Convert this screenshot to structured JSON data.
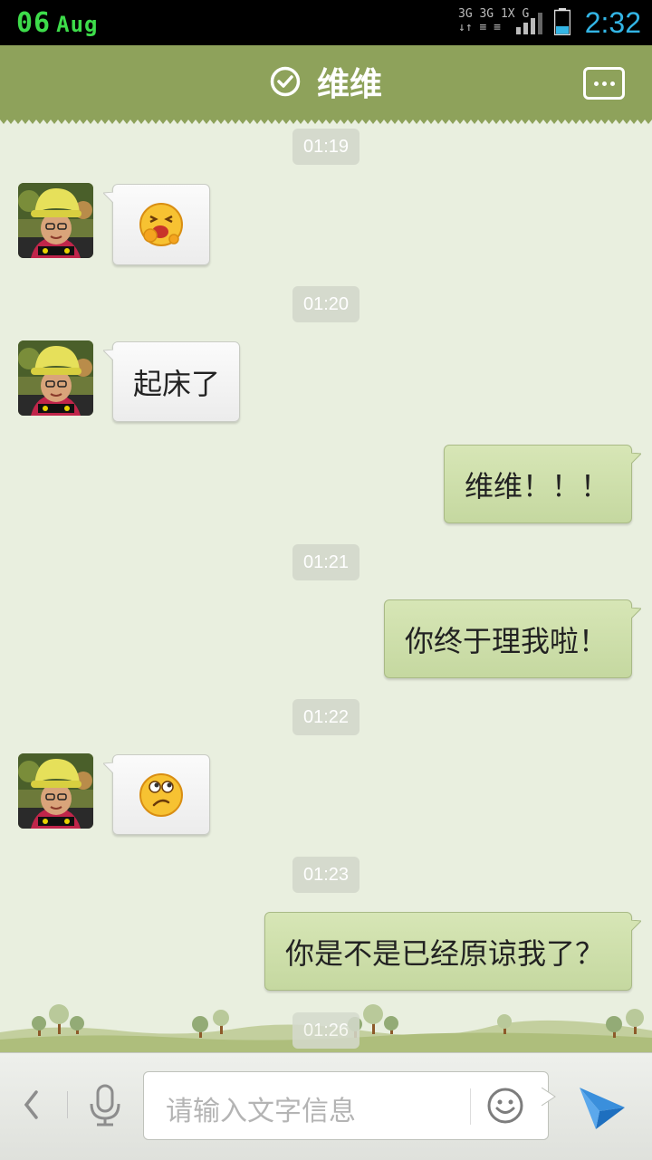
{
  "status": {
    "day": "06",
    "month": "Aug",
    "net_top": "3G 3G 1X  G",
    "time": "2:32"
  },
  "header": {
    "title": "维维"
  },
  "messages": {
    "t1": "01:19",
    "t2": "01:20",
    "m2": "起床了",
    "m3": "维维！！！",
    "t3": "01:21",
    "m4": "你终于理我啦！",
    "t4": "01:22",
    "t5": "01:23",
    "m6": "你是不是已经原谅我了？",
    "t6": "01:26"
  },
  "input": {
    "placeholder": "请输入文字信息"
  },
  "colors": {
    "header": "#8ea25b",
    "background": "#e9efdf",
    "incoming": "#f5f5f5",
    "outgoing": "#cddfa9",
    "time_accent": "#33b5e5",
    "date_accent": "#3ddc4a"
  }
}
